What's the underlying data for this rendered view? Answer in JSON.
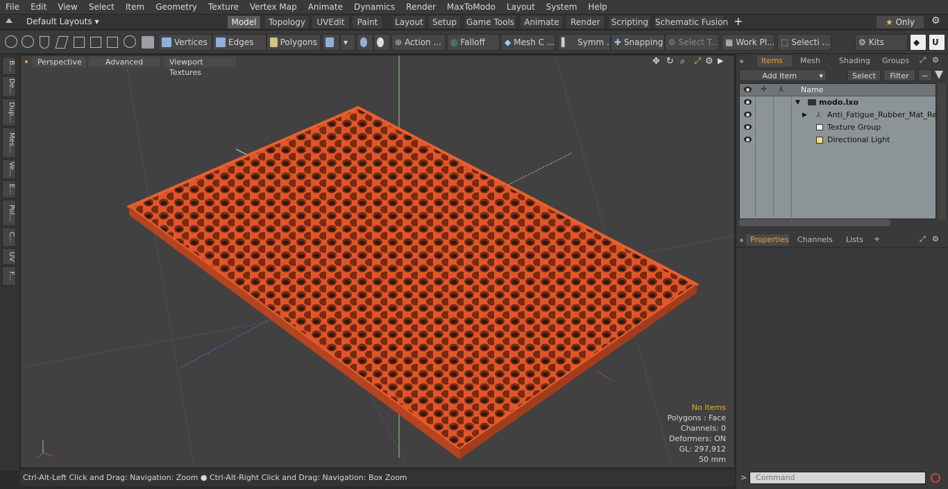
{
  "menu": [
    "File",
    "Edit",
    "View",
    "Select",
    "Item",
    "Geometry",
    "Texture",
    "Vertex Map",
    "Animate",
    "Dynamics",
    "Render",
    "MaxToModo",
    "Layout",
    "System",
    "Help"
  ],
  "layout_selector": "Default Layouts",
  "layout_tabs": [
    "Model",
    "Topology",
    "UVEdit",
    "Paint",
    "Layout",
    "Setup",
    "Game Tools",
    "Animate",
    "Render",
    "Scripting",
    "Schematic Fusion"
  ],
  "only_label": "Only",
  "toolbar": {
    "vertices": "Vertices",
    "edges": "Edges",
    "polygons": "Polygons",
    "action": "Action ...",
    "falloff": "Falloff",
    "meshc": "Mesh C ...",
    "symm": "Symm ...",
    "snapping": "Snapping",
    "selectt": "Select T...",
    "workpl": "Work Pl...",
    "selecti": "Selecti ...",
    "kits": "Kits"
  },
  "left_tabs": [
    "B...",
    "De...",
    "Dup...",
    "Mes...",
    "Ve...",
    "E...",
    "Pol...",
    "C...",
    "UV",
    "F..."
  ],
  "viewport": {
    "perspective": "Perspective",
    "advanced": "Advanced",
    "textures": "Viewport Textures",
    "info": {
      "no_items": "No Items",
      "polygons": "Polygons : Face",
      "channels": "Channels: 0",
      "deformers": "Deformers: ON",
      "gl": "GL: 297,912",
      "scale": "50 mm"
    }
  },
  "status": "Ctrl-Alt-Left Click and Drag: Navigation: Zoom ● Ctrl-Alt-Right Click and Drag: Navigation: Box Zoom",
  "items_panel": {
    "tabs": [
      "Items",
      "Mesh ...",
      "Shading",
      "Groups"
    ],
    "add_item": "Add Item",
    "select": "Select",
    "filter": "Filter",
    "name_header": "Name",
    "rows": [
      "modo.lxo",
      "Anti_Fatigue_Rubber_Mat_Red",
      "Texture Group",
      "Directional Light"
    ]
  },
  "props_panel": {
    "tabs": [
      "Properties",
      "Channels",
      "Lists"
    ]
  },
  "command_placeholder": "Command",
  "colors": {
    "mat": "#e0562a",
    "accent": "#f0a030"
  }
}
